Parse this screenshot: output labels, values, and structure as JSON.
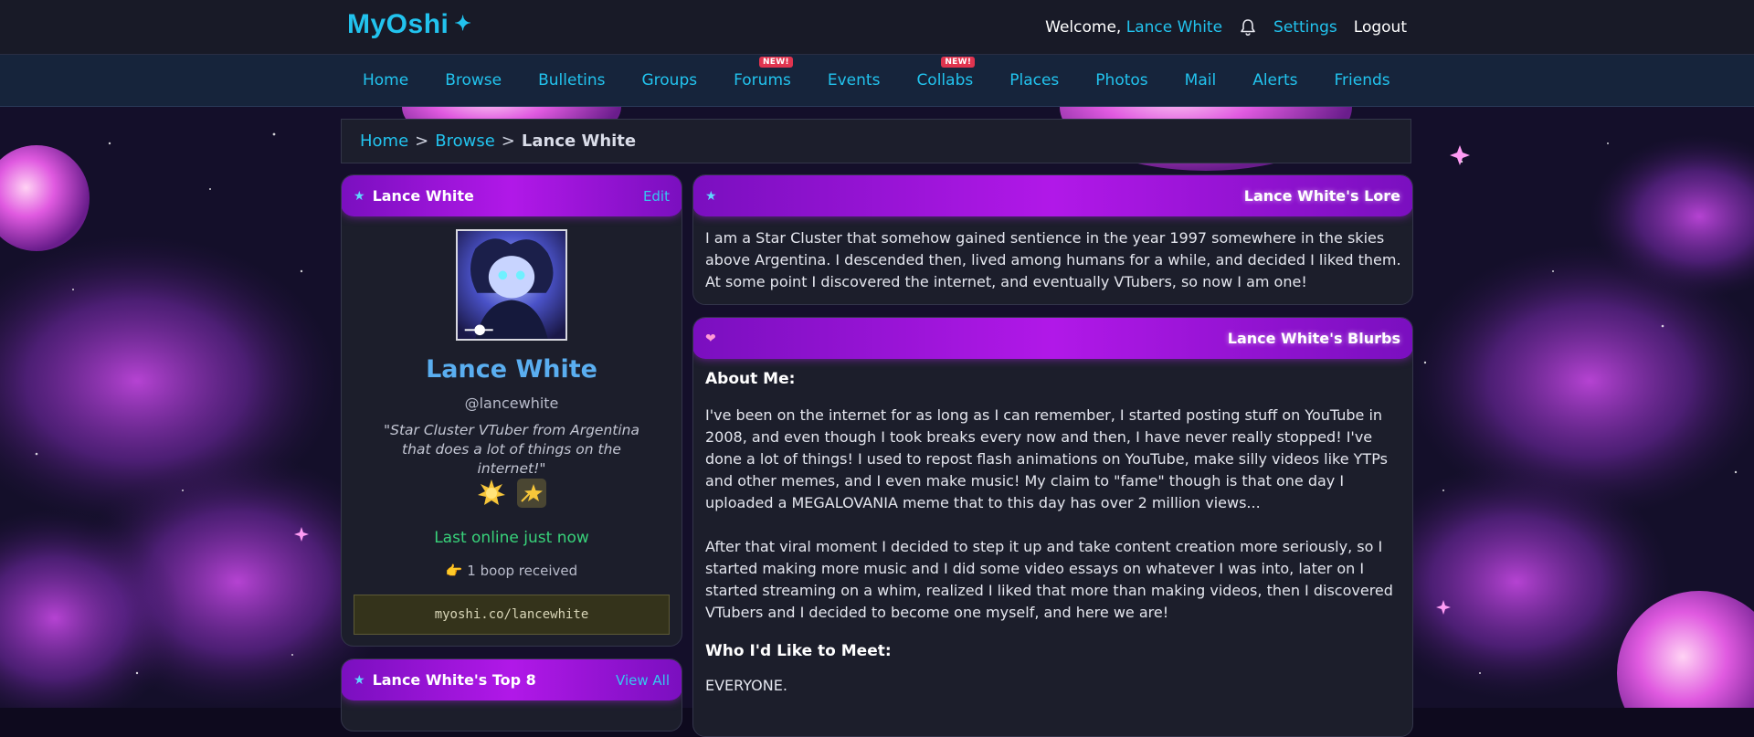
{
  "brand": {
    "name": "MyOshi",
    "sparkle": "✦"
  },
  "topbar": {
    "welcome": "Welcome,",
    "username": "Lance White",
    "settings": "Settings",
    "logout": "Logout",
    "bell_icon": "bell-icon"
  },
  "nav": {
    "items": [
      {
        "label": "Home"
      },
      {
        "label": "Browse"
      },
      {
        "label": "Bulletins"
      },
      {
        "label": "Groups"
      },
      {
        "label": "Forums",
        "badge": "NEW!"
      },
      {
        "label": "Events"
      },
      {
        "label": "Collabs",
        "badge": "NEW!"
      },
      {
        "label": "Places"
      },
      {
        "label": "Photos"
      },
      {
        "label": "Mail"
      },
      {
        "label": "Alerts"
      },
      {
        "label": "Friends"
      }
    ]
  },
  "breadcrumb": {
    "home": "Home",
    "sep": ">",
    "browse": "Browse",
    "current": "Lance White"
  },
  "profile": {
    "header_title": "Lance White",
    "edit_label": "Edit",
    "name": "Lance White",
    "handle": "@lancewhite",
    "quote": "\"Star Cluster VTuber from Argentina that does a lot of things on the internet!\"",
    "last_online": "Last online just now",
    "boops": "👉 1 boop received",
    "url": "myoshi.co/lancewhite"
  },
  "top8": {
    "title": "Lance White's Top 8",
    "view_all": "View All"
  },
  "lore": {
    "title": "Lance White's Lore",
    "text": "I am a Star Cluster that somehow gained sentience in the year 1997 somewhere in the skies above Argentina. I descended then, lived among humans for a while, and decided I liked them. At some point I discovered the internet, and eventually VTubers, so now I am one!"
  },
  "blurbs": {
    "title": "Lance White's Blurbs",
    "about_heading": "About Me:",
    "about_p1": "I've been on the internet for as long as I can remember, I started posting stuff on YouTube in 2008, and even though I took breaks every now and then, I have never really stopped! I've done a lot of things! I used to repost flash animations on YouTube, make silly videos like YTPs and other memes, and I even make music! My claim to \"fame\" though is that one day I uploaded a MEGALOVANIA meme that to this day has over 2 million views...",
    "about_p2": "After that viral moment I decided to step it up and take content creation more seriously, so I started making more music and I did some video essays on whatever I was into, later on I started streaming on a whim, realized I liked that more than making videos, then I discovered VTubers and I decided to become one myself, and here we are!",
    "meet_heading": "Who I'd Like to Meet:",
    "meet_text": "EVERYONE."
  },
  "colors": {
    "accent": "#22c3ee",
    "header_gradient": "#b118e8",
    "online": "#38d27a",
    "badge_new": "#e0344f"
  }
}
